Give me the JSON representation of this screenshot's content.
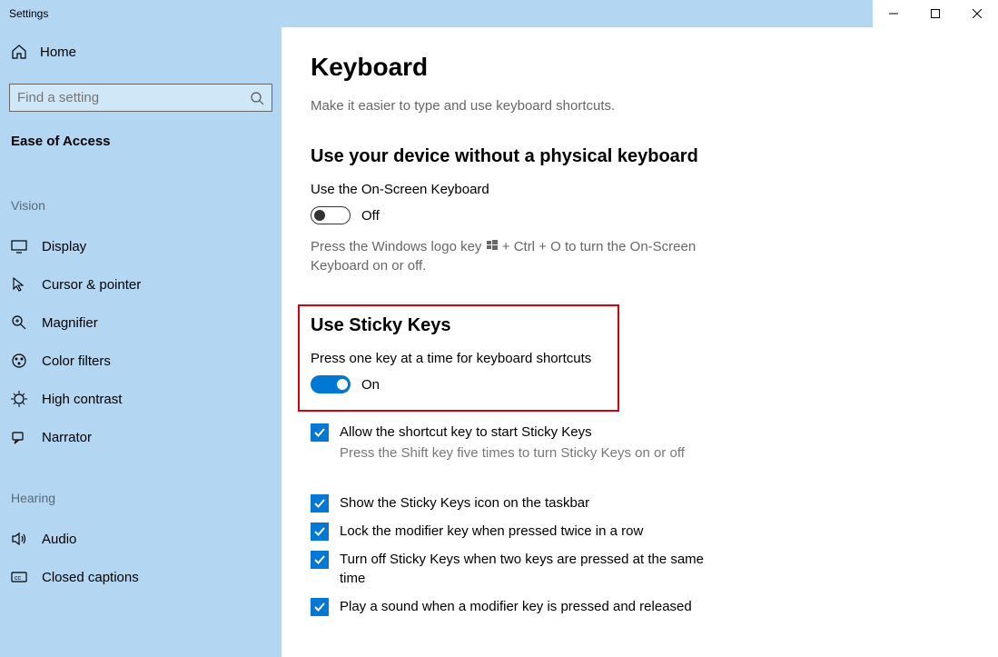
{
  "window": {
    "title": "Settings"
  },
  "sidebar": {
    "home": "Home",
    "search_placeholder": "Find a setting",
    "section": "Ease of Access",
    "groups": [
      {
        "label": "Vision",
        "items": [
          {
            "label": "Display"
          },
          {
            "label": "Cursor & pointer"
          },
          {
            "label": "Magnifier"
          },
          {
            "label": "Color filters"
          },
          {
            "label": "High contrast"
          },
          {
            "label": "Narrator"
          }
        ]
      },
      {
        "label": "Hearing",
        "items": [
          {
            "label": "Audio"
          },
          {
            "label": "Closed captions"
          }
        ]
      }
    ]
  },
  "main": {
    "title": "Keyboard",
    "subtitle": "Make it easier to type and use keyboard shortcuts.",
    "section1": {
      "heading": "Use your device without a physical keyboard",
      "label": "Use the On-Screen Keyboard",
      "toggle_state": "Off",
      "desc_before": "Press the Windows logo key ",
      "desc_after": " + Ctrl + O to turn the On-Screen Keyboard on or off."
    },
    "section2": {
      "heading": "Use Sticky Keys",
      "label": "Press one key at a time for keyboard shortcuts",
      "toggle_state": "On",
      "check1": "Allow the shortcut key to start Sticky Keys",
      "hint1": "Press the Shift key five times to turn Sticky Keys on or off",
      "check2": "Show the Sticky Keys icon on the taskbar",
      "check3": "Lock the modifier key when pressed twice in a row",
      "check4": "Turn off Sticky Keys when two keys are pressed at the same time",
      "check5": "Play a sound when a modifier key is pressed and released"
    }
  }
}
